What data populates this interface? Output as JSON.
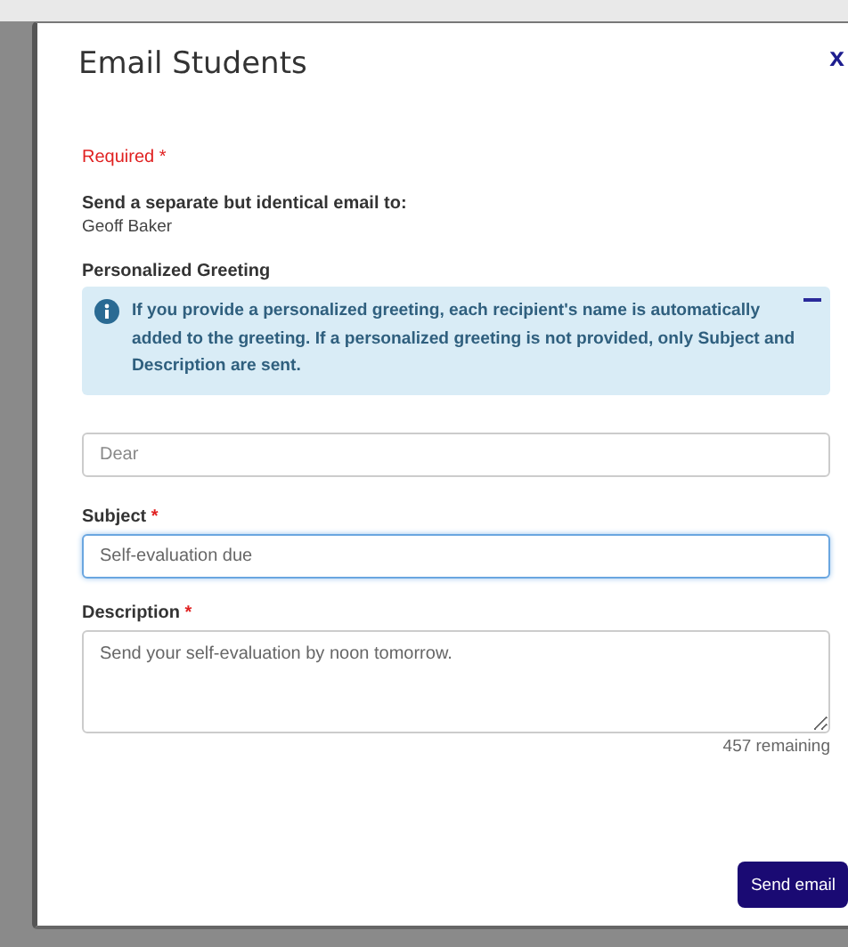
{
  "dialog": {
    "title": "Email Students",
    "close": "x"
  },
  "required_legend": {
    "label": "Required",
    "marker": "*"
  },
  "recipients": {
    "label": "Send a separate but identical email to:",
    "names": [
      "Geoff Baker"
    ]
  },
  "greeting": {
    "label": "Personalized Greeting",
    "info": "If you provide a personalized greeting, each recipient's name is automatically added to the greeting. If a personalized greeting is not provided, only Subject and Description are sent.",
    "placeholder": "Dear"
  },
  "fields": [
    {
      "kind": "input",
      "label": "Subject",
      "required": true,
      "value": "Self-evaluation due",
      "focused": true
    },
    {
      "kind": "textarea",
      "label": "Description",
      "required": true,
      "value": "Send your self-evaluation by noon tomorrow.",
      "focused": false,
      "counter": "457 remaining"
    }
  ],
  "send_button": "Send email"
}
